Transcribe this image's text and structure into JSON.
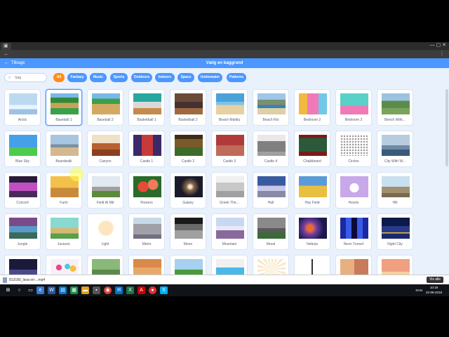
{
  "browser": {
    "tab_favicon": "▣",
    "window_controls": "—  ▢  ✕",
    "back_icon": "←",
    "menu_icon": "⋮"
  },
  "header": {
    "back_label": "Tilbage",
    "back_icon": "←",
    "title": "Vælg en baggrund"
  },
  "filters": {
    "search_placeholder": "Søg",
    "search_icon": "⌕",
    "tags": [
      "All",
      "Fantasy",
      "Music",
      "Sports",
      "Outdoors",
      "Indoors",
      "Space",
      "Underwater",
      "Patterns"
    ],
    "active_tag": "All"
  },
  "backdrops": [
    {
      "label": "Arctic",
      "theme": "arctic"
    },
    {
      "label": "Baseball 1",
      "theme": "baseball1"
    },
    {
      "label": "Baseball 2",
      "theme": "baseball2"
    },
    {
      "label": "Basketball 1",
      "theme": "basketball1"
    },
    {
      "label": "Basketball 2",
      "theme": "basketball2"
    },
    {
      "label": "Beach Malibu",
      "theme": "malibu"
    },
    {
      "label": "Beach Rio",
      "theme": "rio"
    },
    {
      "label": "Bedroom 2",
      "theme": "bedroom2"
    },
    {
      "label": "Bedroom 3",
      "theme": "bedroom3"
    },
    {
      "label": "Bench With...",
      "theme": "bench"
    },
    {
      "label": "Blue Sky",
      "theme": "bluesky"
    },
    {
      "label": "Boardwalk",
      "theme": "boardwalk"
    },
    {
      "label": "Canyon",
      "theme": "canyon"
    },
    {
      "label": "Castle 1",
      "theme": "castle1"
    },
    {
      "label": "Castle 2",
      "theme": "castle2"
    },
    {
      "label": "Castle 3",
      "theme": "castle3"
    },
    {
      "label": "Castle 4",
      "theme": "castle4"
    },
    {
      "label": "Chalkboard",
      "theme": "chalkboard"
    },
    {
      "label": "Circles",
      "theme": "circles"
    },
    {
      "label": "City With W...",
      "theme": "city"
    },
    {
      "label": "Concert",
      "theme": "concert"
    },
    {
      "label": "Farm",
      "theme": "farm"
    },
    {
      "label": "Field At Mit",
      "theme": "fieldmit"
    },
    {
      "label": "Flowers",
      "theme": "flowers"
    },
    {
      "label": "Galaxy",
      "theme": "galaxy"
    },
    {
      "label": "Greek The...",
      "theme": "greek"
    },
    {
      "label": "Hall",
      "theme": "hall"
    },
    {
      "label": "Hay Field",
      "theme": "hayfield"
    },
    {
      "label": "Hearts",
      "theme": "hearts"
    },
    {
      "label": "Hill",
      "theme": "hill"
    },
    {
      "label": "Jungle",
      "theme": "jungle"
    },
    {
      "label": "Jurassic",
      "theme": "jurassic"
    },
    {
      "label": "Light",
      "theme": "light"
    },
    {
      "label": "Metro",
      "theme": "metro"
    },
    {
      "label": "Moon",
      "theme": "moon"
    },
    {
      "label": "Mountain",
      "theme": "mountain"
    },
    {
      "label": "Mural",
      "theme": "mural"
    },
    {
      "label": "Nebula",
      "theme": "nebula"
    },
    {
      "label": "Neon Tunnel",
      "theme": "neon"
    },
    {
      "label": "Night City",
      "theme": "nightcity"
    },
    {
      "label": "",
      "theme": "nightcity2"
    },
    {
      "label": "",
      "theme": "party"
    },
    {
      "label": "",
      "theme": "pathway"
    },
    {
      "label": "",
      "theme": "playground"
    },
    {
      "label": "",
      "theme": "playingfield"
    },
    {
      "label": "",
      "theme": "pool"
    },
    {
      "label": "",
      "theme": "rays"
    },
    {
      "label": "",
      "theme": "refrigerator"
    },
    {
      "label": "",
      "theme": "room1"
    },
    {
      "label": "",
      "theme": "room2"
    }
  ],
  "selected_index": 1,
  "download": {
    "file_name": "813180_lava-sri-...mp4",
    "show_all": "Vis alle"
  },
  "taskbar": {
    "lang": "DAN",
    "time": "10:19",
    "date": "22-08-2018"
  },
  "colors": {
    "header_blue": "#4c97ff",
    "active_tag_orange": "#ff8c1a",
    "page_bg": "#e9f1fc"
  }
}
